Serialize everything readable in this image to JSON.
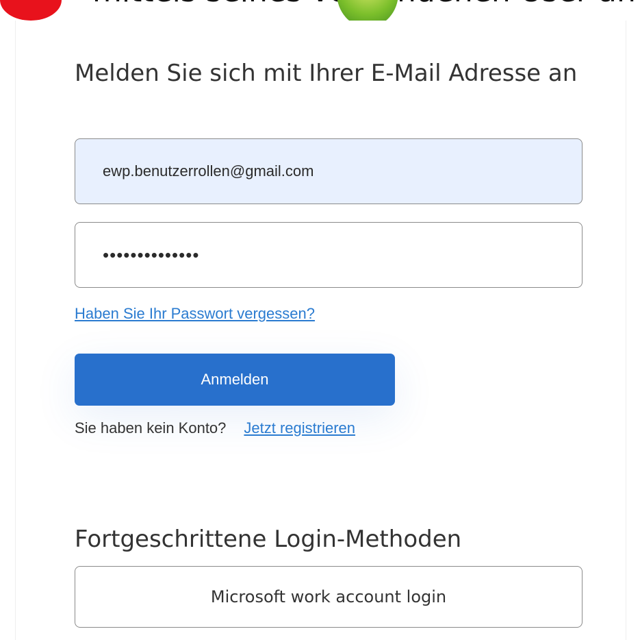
{
  "header": {
    "caption": "mittels seines vorhandenen User an"
  },
  "login": {
    "heading": "Melden Sie sich mit Ihrer E-Mail Adresse an",
    "email_value": "ewp.benutzerrollen@gmail.com",
    "password_mask": "••••••••••••••",
    "forgot_password_link": "Haben Sie Ihr Passwort vergessen?",
    "signin_label": "Anmelden",
    "no_account_text": "Sie haben kein Konto?",
    "register_link": "Jetzt registrieren"
  },
  "advanced": {
    "heading": "Fortgeschrittene Login-Methoden",
    "microsoft_button_label": "Microsoft work account login"
  },
  "colors": {
    "accent": "#2870cc",
    "link": "#2a7bd0",
    "autofill": "#e8f0fe",
    "badge": "#e8121c",
    "logo": "#7bbf2b"
  },
  "icons": {
    "badge": "red-circle-marker",
    "logo": "green-logo-partial"
  }
}
